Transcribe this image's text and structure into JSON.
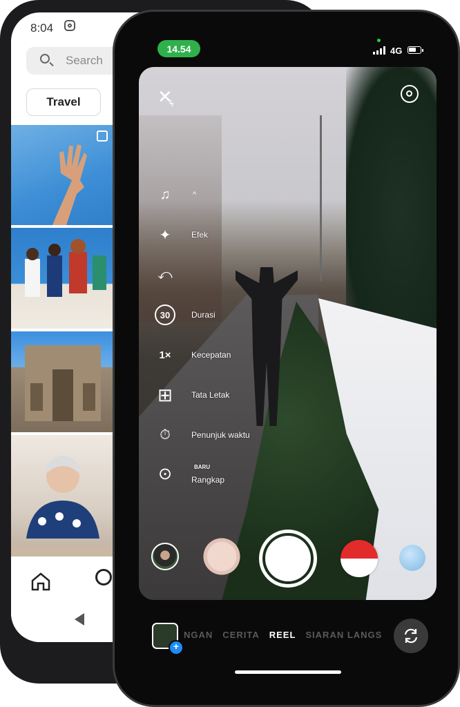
{
  "back_phone": {
    "time": "8:04",
    "search_placeholder": "Search",
    "chip_label": "Travel"
  },
  "status_bar": {
    "time": "14.54",
    "network": "4G"
  },
  "camera": {
    "tools": [
      {
        "icon": "music-icon",
        "glyph": "♫",
        "label": ""
      },
      {
        "icon": "sparkle-icon",
        "glyph": "✦",
        "label": "Efek"
      },
      {
        "icon": "curve-arrow-icon",
        "glyph": "⤺",
        "label": ""
      },
      {
        "icon": "timer-30-icon",
        "glyph": "30",
        "label": "Durasi"
      },
      {
        "icon": "speed-icon",
        "glyph": "1×",
        "label": "Kecepatan"
      },
      {
        "icon": "layout-icon",
        "glyph": "⊞",
        "label": "Tata Letak"
      },
      {
        "icon": "stopwatch-icon",
        "glyph": "⏱",
        "label": "Penunjuk waktu"
      },
      {
        "icon": "dual-camera-icon",
        "glyph": "⊙",
        "label": "Rangkap",
        "badge": "BARU"
      }
    ],
    "modes": [
      "NGAN",
      "CERITA",
      "REEL",
      "SIARAN LANGS"
    ],
    "active_mode": "REEL"
  },
  "colors": {
    "status_green": "#2fb04b",
    "plus_blue": "#1d8cf8",
    "flag_red": "#e22b2b"
  }
}
